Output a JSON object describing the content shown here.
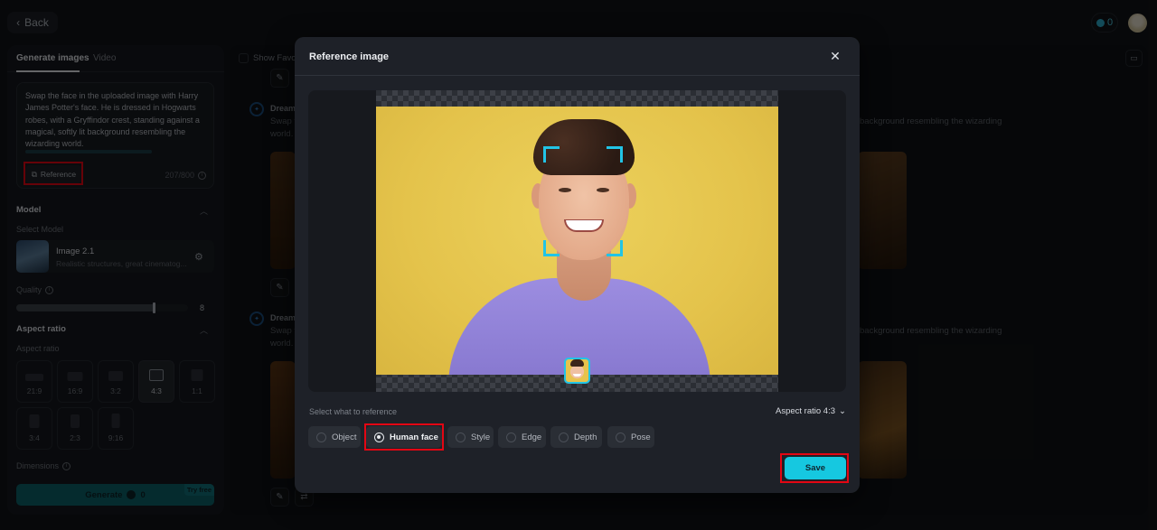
{
  "topbar": {
    "back_label": "Back",
    "credits": "0"
  },
  "left_panel": {
    "tabs": [
      {
        "label": "Generate images",
        "active": true
      },
      {
        "label": "Video",
        "active": false
      }
    ],
    "prompt": {
      "text": "Swap the face in the uploaded image with Harry James Potter's face. He is dressed in Hogwarts robes, with a Gryffindor crest, standing against a magical, softly lit background resembling the wizarding world.",
      "reference_label": "Reference",
      "char_count": "207/800"
    },
    "model_section": {
      "title": "Model",
      "select_label": "Select Model",
      "model_name": "Image 2.1",
      "model_desc": "Realistic structures, great cinematog..."
    },
    "quality": {
      "label": "Quality",
      "value": "8",
      "fraction": 0.8
    },
    "aspect_section": {
      "title": "Aspect ratio",
      "sub_label": "Aspect ratio",
      "ratios": [
        "21:9",
        "16:9",
        "3:2",
        "4:3",
        "1:1",
        "3:4",
        "2:3",
        "9:16"
      ],
      "selected": "4:3"
    },
    "dimensions_label": "Dimensions",
    "generate": {
      "label": "Generate",
      "cost": "0",
      "badge": "Try free"
    }
  },
  "right_panel": {
    "show_favorites_label": "Show Favorites",
    "results": [
      {
        "title": "Dreamina",
        "text_left": "Swap t",
        "text_left2": "world.",
        "text_right": "background resembling the wizarding"
      },
      {
        "title": "Dreamina",
        "text_left": "Swap t",
        "text_left2": "world.",
        "text_right": "background resembling the wizarding"
      }
    ]
  },
  "modal": {
    "title": "Reference image",
    "select_label": "Select what to reference",
    "aspect_label": "Aspect ratio 4:3",
    "options": [
      {
        "label": "Object",
        "selected": false
      },
      {
        "label": "Human face",
        "selected": true
      },
      {
        "label": "Style",
        "selected": false
      },
      {
        "label": "Edge",
        "selected": false
      },
      {
        "label": "Depth",
        "selected": false
      },
      {
        "label": "Pose",
        "selected": false
      }
    ],
    "save_label": "Save"
  },
  "colors": {
    "accent": "#16c8e0",
    "highlight": "#e30613",
    "face_box": "#22c4e6"
  }
}
